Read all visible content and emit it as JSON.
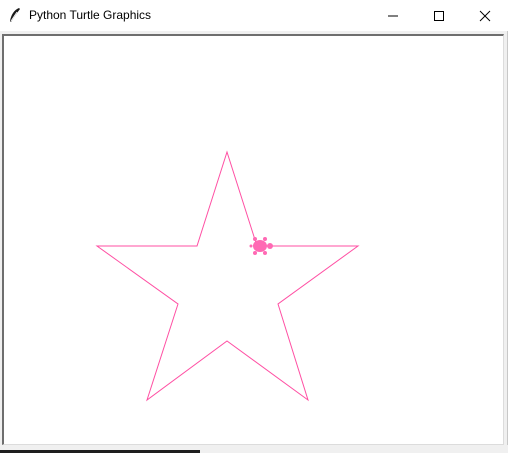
{
  "window": {
    "title": "Python Turtle Graphics",
    "icons": {
      "app": "feather-icon",
      "minimize": "minimize-icon",
      "maximize": "maximize-icon",
      "close": "close-icon"
    }
  },
  "canvas": {
    "background": "#ffffff",
    "drawing": {
      "shape": "five-pointed star",
      "stroke_color": "#ff4fa3"
    },
    "turtle": {
      "shape": "turtle",
      "color": "#ff69b4",
      "heading": "west"
    }
  }
}
